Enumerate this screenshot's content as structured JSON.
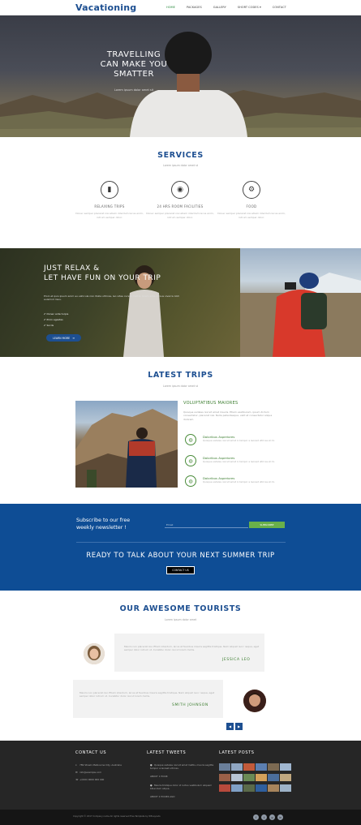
{
  "nav": {
    "brand": "Vacationing",
    "items": [
      {
        "label": "HOME",
        "active": true
      },
      {
        "label": "PACKAGES",
        "active": false
      },
      {
        "label": "GALLERY",
        "active": false
      },
      {
        "label": "SHORT CODES",
        "active": false
      },
      {
        "label": "CONTACT",
        "active": false
      }
    ]
  },
  "hero": {
    "title_line1": "TRAVELLING",
    "title_line2": "CAN MAKE YOU",
    "title_line3": "SMATTER",
    "subtitle": "Lorem ipsum dolor amet sit"
  },
  "services": {
    "title": "SERVICES",
    "subtitle": "Lorem ipsum dolor amet st",
    "items": [
      {
        "icon": "map-icon",
        "glyph": "▮",
        "title": "RELAXING TRIPS",
        "desc": "Donec semper placerat nisi etiam interdum lacus enim, rutrum semper dolor."
      },
      {
        "icon": "globe-icon",
        "glyph": "◉",
        "title": "24 HRS ROOM FACILITIES",
        "desc": "Donec semper placerat nisi etiam interdum lacus enim, rutrum semper dolor."
      },
      {
        "icon": "gears-icon",
        "glyph": "⚙",
        "title": "FOOD",
        "desc": "Donec semper placerat nisi etiam interdum lacus enim, rutrum semper dolor."
      }
    ]
  },
  "relax": {
    "line1": "JUST RELAX &",
    "line2": "LET HAVE FUN ON YOUR TRIP",
    "para": "Proin et quis ipsum anim eu vehicula nisl. Nulla ultrices, leo vitae cursus mattis, lorem ante cursus viverra nibh euismod risus.",
    "list": [
      "Donec ante turpis",
      "Proin egestas",
      "Sociis"
    ],
    "button": "LEARN MORE"
  },
  "trips": {
    "title": "LATEST TRIPS",
    "subtitle": "Lorem ipsum dolor amet st",
    "heading": "VOLUPTATIBUS MAIORES",
    "para": "Quisque sodales nisl sit amet mauris. Etiam vestibulum, ipsum dictum consectetur, placerat nisi. Nulla pellentesque, velit at consectetur aliqua dolorem.",
    "features": [
      {
        "title": "Doloribus Asperiores",
        "desc": "Quisque sodales nisl sit amet in tempor a laoreet ultrices et mi."
      },
      {
        "title": "Doloribus Asperiores",
        "desc": "Quisque sodales nisl sit amet in tempor a laoreet ultrices et mi."
      },
      {
        "title": "Doloribus Asperiores",
        "desc": "Quisque sodales nisl sit amet in tempor a laoreet ultrices et mi."
      }
    ]
  },
  "subscribe": {
    "line1": "Subscribe to our free",
    "line2": "weekly newsletter !",
    "placeholder": "Email",
    "button": "SUBSCRIBE",
    "cta": "READY TO TALK ABOUT YOUR NEXT SUMMER TRIP",
    "contact_button": "CONTACT US"
  },
  "tourists": {
    "title": "OUR AWESOME TOURISTS",
    "subtitle": "Lorem ipsum dolor amet",
    "items": [
      {
        "quote": "Mauris non placerat nisi. Etiam interdum, lacus at faucibus mauris sagittis tristique. Nam aliquet nunc neque, eget semper dolor rutrum ut. Curabitur dolor nisi ut lorem mollis.",
        "name": "JESSICA LEO"
      },
      {
        "quote": "Mauris non placerat nisi. Etiam interdum, lacus at faucibus mauris sagittis tristique. Nam aliquet nunc neque, eget semper dolor rutrum ut. Curabitur dolor nisi ut lorem mollis.",
        "name": "SMITH JOHNSON"
      }
    ],
    "prev": "◀",
    "next": "▶"
  },
  "footer": {
    "contact_title": "CONTACT US",
    "contact_lines": [
      {
        "icon": "location-icon",
        "glyph": "⌖",
        "text": "789 Street, Melbourne City, Australia"
      },
      {
        "icon": "mail-icon",
        "glyph": "✉",
        "text": "info@example.com"
      },
      {
        "icon": "phone-icon",
        "glyph": "☏",
        "text": "+(000) 0000 000 000"
      }
    ],
    "tweets_title": "LATEST TWEETS",
    "tweets": [
      {
        "text": "Quisque sodales nisl sit amet mattis, mauris sagittis tempor a laoreet ultrices.",
        "time": "ABOUT 1 HOUR"
      },
      {
        "text": "Mauris tristique dolor id luctus vestibulum aliquam bibendum aliqua.",
        "time": "ABOUT 2 HOURS AGO"
      }
    ],
    "posts_title": "LATEST POSTS",
    "copyright": "Copyright © 2017 Company name All rights reserved Free Template by W3Layouts"
  },
  "colors": {
    "brand_blue": "#1d4f91",
    "accent_green": "#3b7d2f",
    "band_blue": "#0e4d95",
    "footer_dark": "#262626"
  }
}
